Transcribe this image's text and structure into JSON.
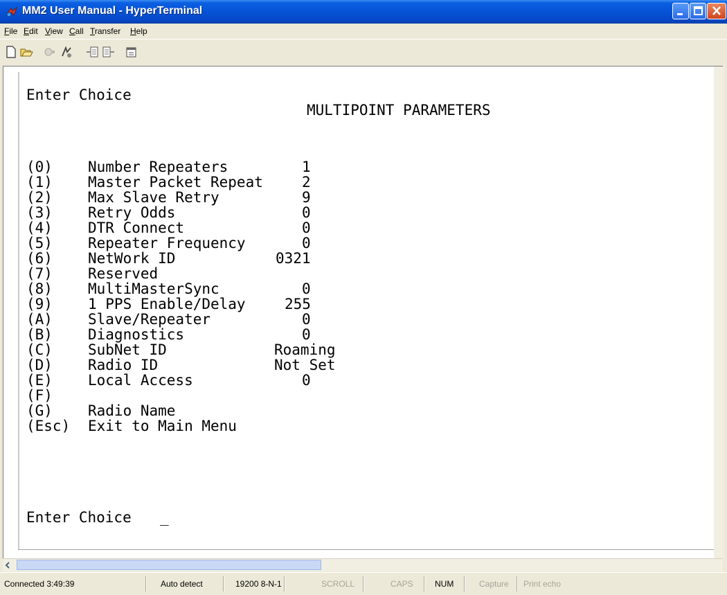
{
  "window": {
    "title": "MM2 User Manual - HyperTerminal"
  },
  "menu": [
    "File",
    "Edit",
    "View",
    "Call",
    "Transfer",
    "Help"
  ],
  "toolbar": [
    "new-icon",
    "open-icon",
    "connect-icon",
    "disconnect-icon",
    "send-icon",
    "receive-icon",
    "properties-icon"
  ],
  "terminal": {
    "header_prompt": "Enter Choice",
    "title": "MULTIPOINT PARAMETERS",
    "params": [
      {
        "key": "(0)",
        "label": "Number Repeaters",
        "value": "1"
      },
      {
        "key": "(1)",
        "label": "Master Packet Repeat",
        "value": "2"
      },
      {
        "key": "(2)",
        "label": "Max Slave Retry",
        "value": "9"
      },
      {
        "key": "(3)",
        "label": "Retry Odds",
        "value": "0"
      },
      {
        "key": "(4)",
        "label": "DTR Connect",
        "value": "0"
      },
      {
        "key": "(5)",
        "label": "Repeater Frequency",
        "value": "0"
      },
      {
        "key": "(6)",
        "label": "NetWork ID",
        "value": "0321"
      },
      {
        "key": "(7)",
        "label": "Reserved",
        "value": ""
      },
      {
        "key": "(8)",
        "label": "MultiMasterSync",
        "value": "0"
      },
      {
        "key": "(9)",
        "label": "1 PPS Enable/Delay",
        "value": "255"
      },
      {
        "key": "(A)",
        "label": "Slave/Repeater",
        "value": "0"
      },
      {
        "key": "(B)",
        "label": "Diagnostics",
        "value": "0"
      },
      {
        "key": "(C)",
        "label": "SubNet ID",
        "value": "Roaming"
      },
      {
        "key": "(D)",
        "label": "Radio ID",
        "value": "Not Set"
      },
      {
        "key": "(E)",
        "label": "Local Access",
        "value": "0"
      },
      {
        "key": "(F)",
        "label": "",
        "value": ""
      },
      {
        "key": "(G)",
        "label": "Radio Name",
        "value": ""
      }
    ],
    "exit_key": "(Esc)",
    "exit_label": "Exit to Main Menu",
    "prompt": "Enter Choice",
    "cursor": "_"
  },
  "status": {
    "connected": "Connected 3:49:39",
    "detect": "Auto detect",
    "port": "19200 8-N-1",
    "scroll": "SCROLL",
    "caps": "CAPS",
    "num": "NUM",
    "capture": "Capture",
    "print_echo": "Print echo"
  }
}
